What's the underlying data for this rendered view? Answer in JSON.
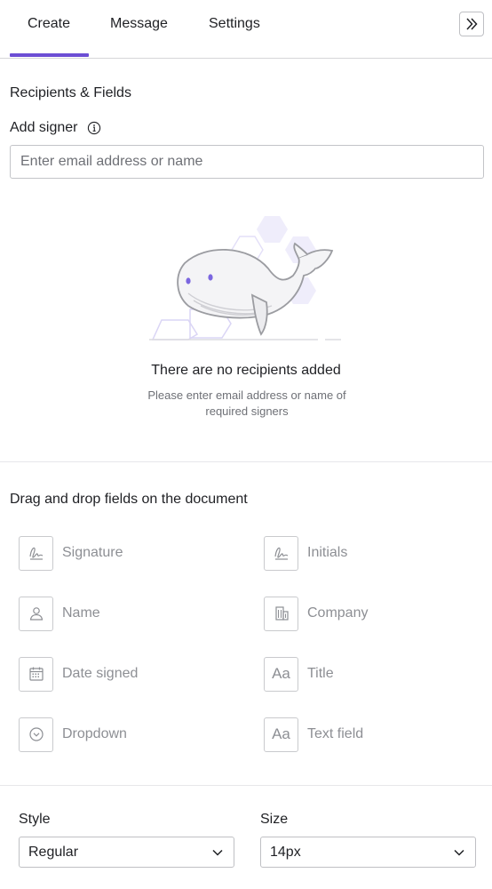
{
  "tabs": [
    {
      "label": "Create"
    },
    {
      "label": "Message"
    },
    {
      "label": "Settings"
    }
  ],
  "active_tab": "Create",
  "accent_color": "#6c4ed4",
  "recipients": {
    "title": "Recipients & Fields",
    "add_signer_label": "Add signer",
    "add_signer_placeholder": "Enter email address or name",
    "add_signer_value": "",
    "empty_title": "There are no recipients added",
    "empty_subtitle": "Please enter email address or name of required signers"
  },
  "fields": {
    "title": "Drag and drop fields on the document",
    "items": [
      {
        "label": "Signature",
        "icon": "signature-icon"
      },
      {
        "label": "Initials",
        "icon": "initials-icon"
      },
      {
        "label": "Name",
        "icon": "person-icon"
      },
      {
        "label": "Company",
        "icon": "building-icon"
      },
      {
        "label": "Date signed",
        "icon": "calendar-icon"
      },
      {
        "label": "Title",
        "icon": "text-aa-icon",
        "glyph": "Aa"
      },
      {
        "label": "Dropdown",
        "icon": "chevron-circle-icon"
      },
      {
        "label": "Text field",
        "icon": "text-aa-icon",
        "glyph": "Aa"
      }
    ]
  },
  "style": {
    "label": "Style",
    "value": "Regular"
  },
  "size": {
    "label": "Size",
    "value": "14px"
  }
}
